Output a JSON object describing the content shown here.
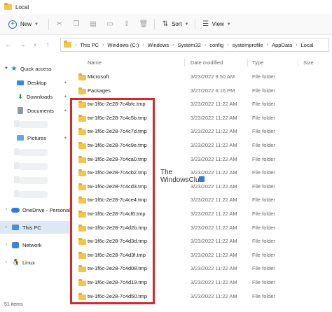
{
  "window": {
    "title": "Local"
  },
  "toolbar": {
    "new_label": "New",
    "sort_label": "Sort",
    "view_label": "View"
  },
  "address": {
    "crumbs": [
      "This PC",
      "Windows (C:)",
      "Windows",
      "System32",
      "config",
      "systemprofile",
      "AppData",
      "Local"
    ]
  },
  "sidebar": {
    "quick_access": "Quick access",
    "desktop": "Desktop",
    "downloads": "Downloads",
    "documents": "Documents",
    "pictures": "Pictures",
    "onedrive": "OneDrive - Personal",
    "this_pc": "This PC",
    "network": "Network",
    "linux": "Linux"
  },
  "columns": {
    "name": "Name",
    "date": "Date modified",
    "type": "Type",
    "size": "Size"
  },
  "files": [
    {
      "name": "Microsoft",
      "date": "3/23/2022 9:50 AM",
      "type": "File folder"
    },
    {
      "name": "Packages",
      "date": "3/27/2022 6:16 PM",
      "type": "File folder"
    },
    {
      "name": "tw-1f6c-2e28-7c4bfc.tmp",
      "date": "3/23/2022 11:22 AM",
      "type": "File folder"
    },
    {
      "name": "tw-1f6c-2e28-7c4c5b.tmp",
      "date": "3/23/2022 11:22 AM",
      "type": "File folder"
    },
    {
      "name": "tw-1f6c-2e28-7c4c7d.tmp",
      "date": "3/23/2022 11:22 AM",
      "type": "File folder"
    },
    {
      "name": "tw-1f6c-2e28-7c4c9e.tmp",
      "date": "3/23/2022 11:22 AM",
      "type": "File folder"
    },
    {
      "name": "tw-1f6c-2e28-7c4ca0.tmp",
      "date": "3/23/2022 11:22 AM",
      "type": "File folder"
    },
    {
      "name": "tw-1f6c-2e28-7c4cb2.tmp",
      "date": "3/23/2022 11:22 AM",
      "type": "File folder"
    },
    {
      "name": "tw-1f6c-2e28-7c4cd3.tmp",
      "date": "3/23/2022 11:22 AM",
      "type": "File folder"
    },
    {
      "name": "tw-1f6c-2e28-7c4ce4.tmp",
      "date": "3/23/2022 11:22 AM",
      "type": "File folder"
    },
    {
      "name": "tw-1f6c-2e28-7c4cf6.tmp",
      "date": "3/23/2022 11:22 AM",
      "type": "File folder"
    },
    {
      "name": "tw-1f6c-2e28-7c4d2b.tmp",
      "date": "3/23/2022 11:22 AM",
      "type": "File folder"
    },
    {
      "name": "tw-1f6c-2e28-7c4d3d.tmp",
      "date": "3/23/2022 11:22 AM",
      "type": "File folder"
    },
    {
      "name": "tw-1f6c-2e28-7c4d3f.tmp",
      "date": "3/23/2022 11:22 AM",
      "type": "File folder"
    },
    {
      "name": "tw-1f6c-2e28-7c4d08.tmp",
      "date": "3/23/2022 11:22 AM",
      "type": "File folder"
    },
    {
      "name": "tw-1f6c-2e28-7c4d19.tmp",
      "date": "3/23/2022 11:22 AM",
      "type": "File folder"
    },
    {
      "name": "tw-1f6c-2e28-7c4d50.tmp",
      "date": "3/23/2022 11:22 AM",
      "type": "File folder"
    }
  ],
  "status": {
    "item_count": "51 items"
  },
  "watermark": {
    "line1": "The",
    "line2": "WindowsClub"
  },
  "colors": {
    "highlight": "#d42a2a",
    "folder": "#f5c54a",
    "selected": "#dce8f5"
  }
}
